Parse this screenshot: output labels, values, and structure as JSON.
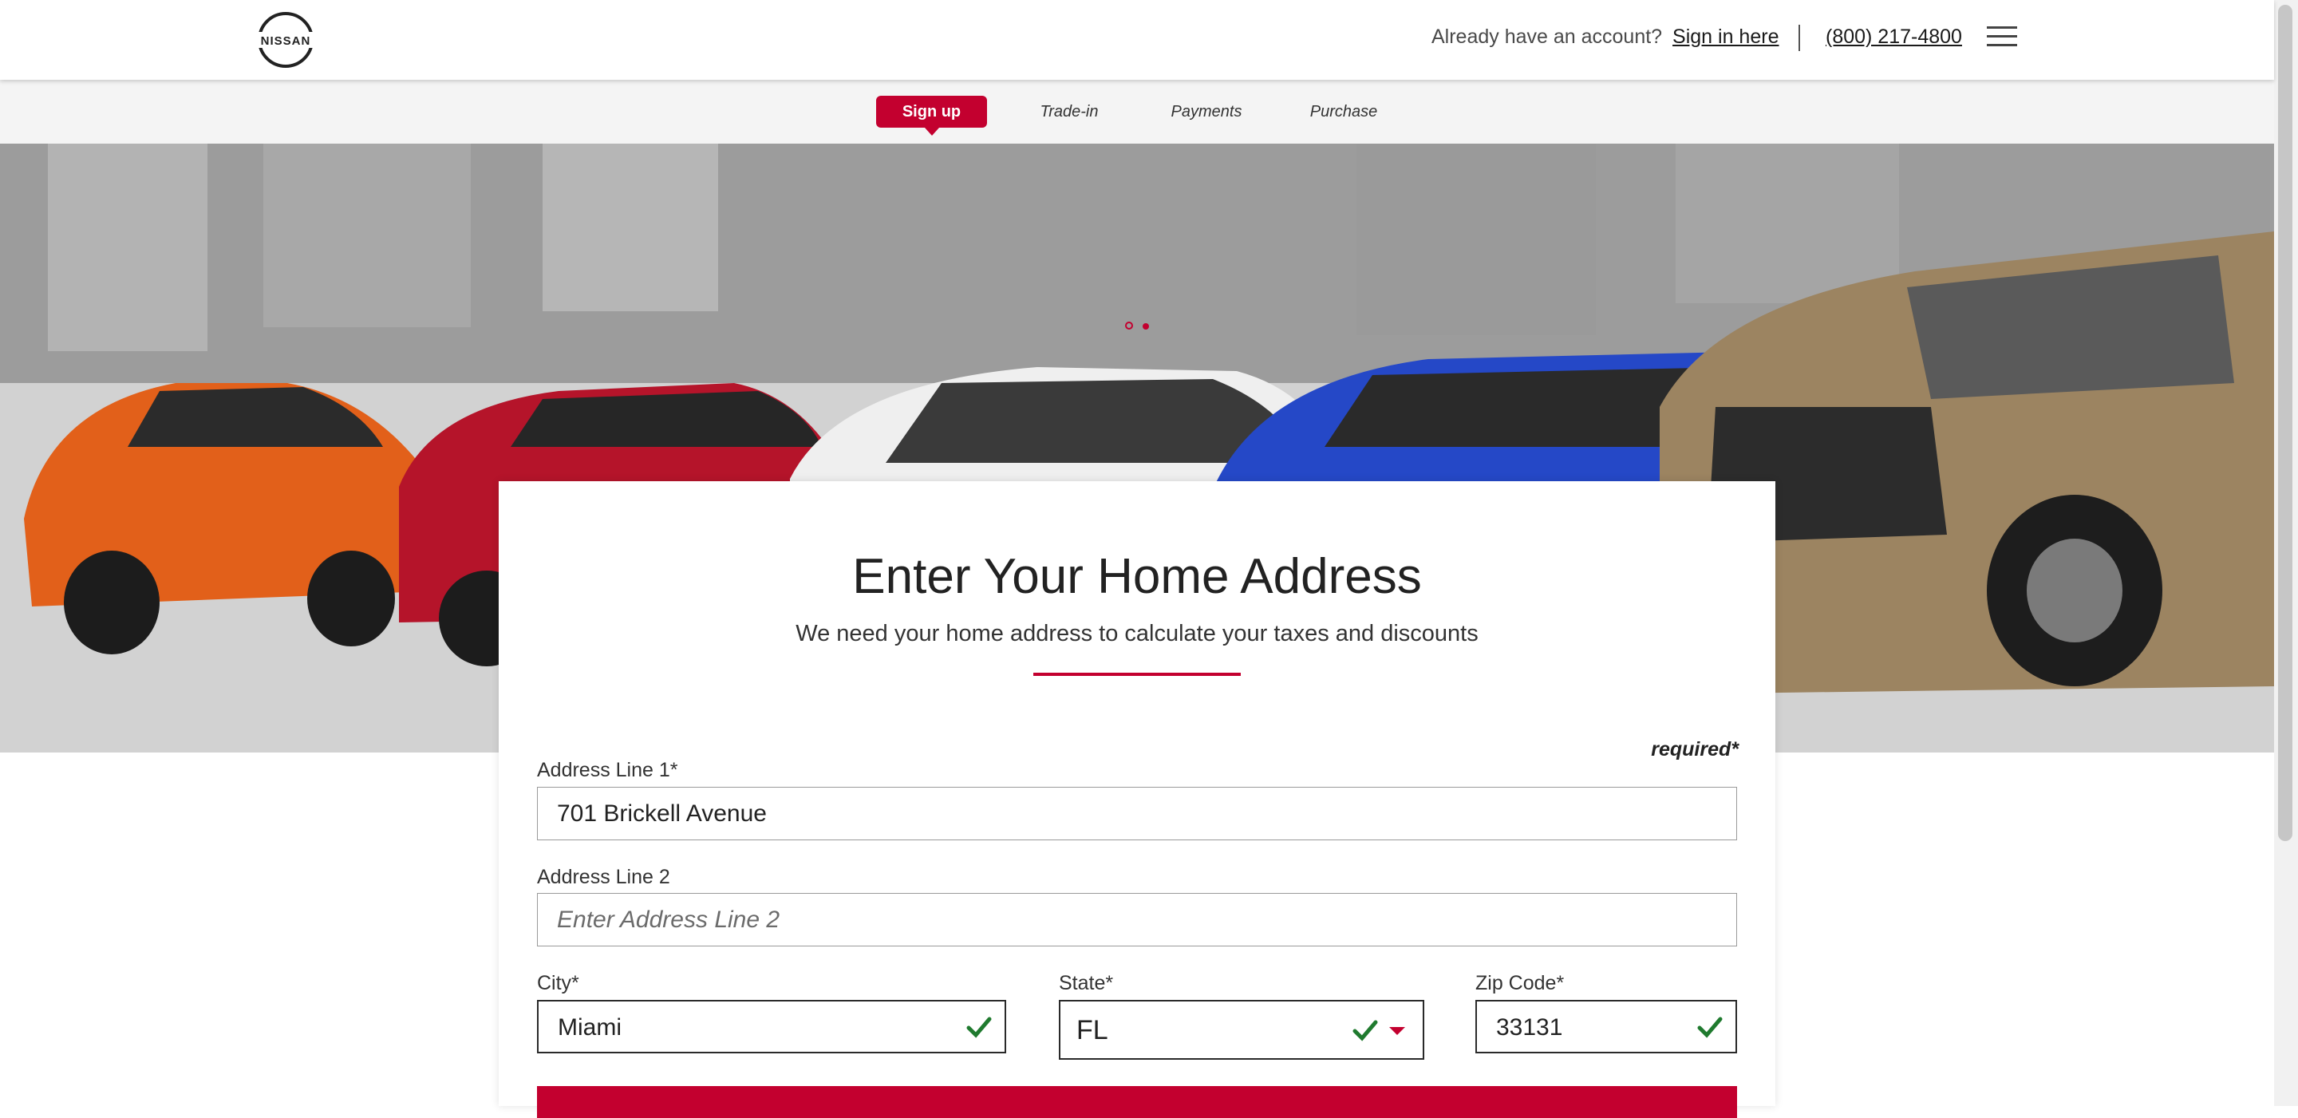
{
  "brand": {
    "logo_text": "NISSAN",
    "accent_color": "#c3002f"
  },
  "header": {
    "account_prompt": "Already have an account?",
    "sign_in_link": "Sign in here",
    "phone": "(800) 217-4800",
    "menu_icon": "hamburger-menu-icon"
  },
  "steps": [
    {
      "label": "Sign up",
      "active": true
    },
    {
      "label": "Trade-in",
      "active": false
    },
    {
      "label": "Payments",
      "active": false
    },
    {
      "label": "Purchase",
      "active": false
    }
  ],
  "carousel": {
    "slide_count": 2,
    "active_slide": 2
  },
  "form": {
    "title": "Enter Your Home Address",
    "subtitle": "We need your home address to calculate your taxes and discounts",
    "required_note": "required*",
    "address1": {
      "label": "Address Line 1*",
      "value": "701 Brickell Avenue"
    },
    "address2": {
      "label": "Address Line 2",
      "value": "",
      "placeholder": "Enter Address Line 2"
    },
    "city": {
      "label": "City*",
      "value": "Miami",
      "valid": true
    },
    "state": {
      "label": "State*",
      "value": "FL",
      "valid": true
    },
    "zip": {
      "label": "Zip Code*",
      "value": "33131",
      "valid": true
    }
  }
}
